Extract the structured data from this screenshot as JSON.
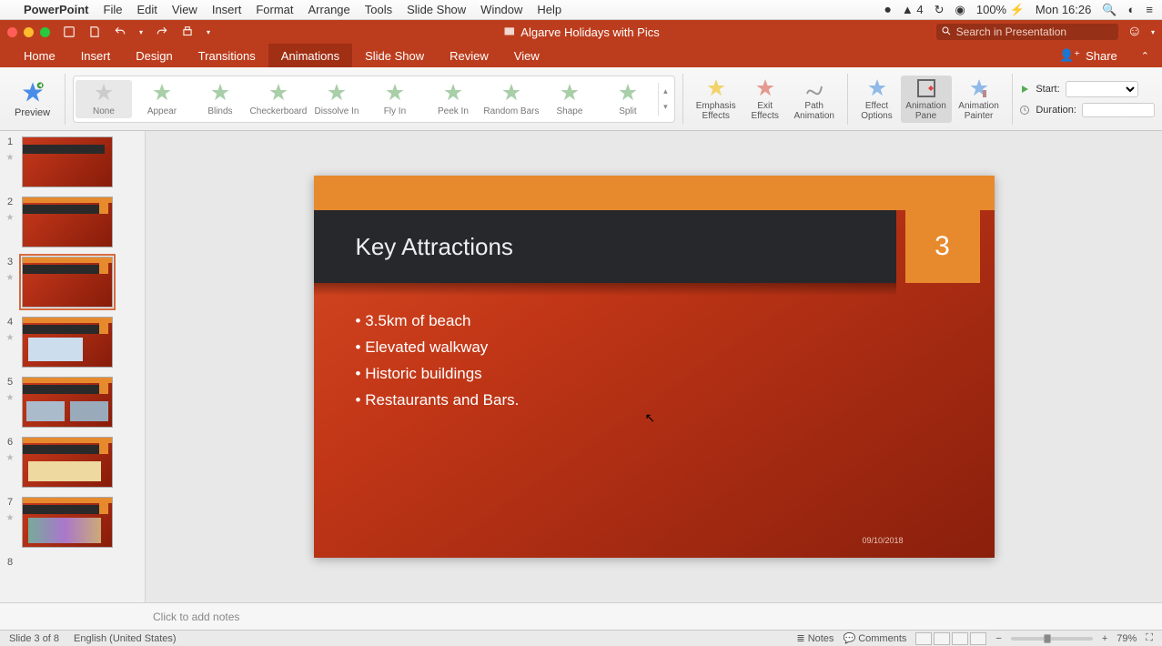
{
  "mac_menu": {
    "app": "PowerPoint",
    "items": [
      "File",
      "Edit",
      "View",
      "Insert",
      "Format",
      "Arrange",
      "Tools",
      "Slide Show",
      "Window",
      "Help"
    ],
    "adobe": "4",
    "battery": "100%",
    "clock": "Mon 16:26"
  },
  "titlebar": {
    "doc_title": "Algarve Holidays with Pics",
    "search_placeholder": "Search in Presentation"
  },
  "tabs": {
    "items": [
      "Home",
      "Insert",
      "Design",
      "Transitions",
      "Animations",
      "Slide Show",
      "Review",
      "View"
    ],
    "active": "Animations",
    "share": "Share"
  },
  "ribbon": {
    "preview": "Preview",
    "gallery": [
      "None",
      "Appear",
      "Blinds",
      "Checkerboard",
      "Dissolve In",
      "Fly In",
      "Peek In",
      "Random Bars",
      "Shape",
      "Split"
    ],
    "tools": {
      "emphasis": "Emphasis Effects",
      "exit": "Exit Effects",
      "path": "Path Animation",
      "options": "Effect Options",
      "pane": "Animation Pane",
      "painter": "Animation Painter"
    },
    "timing": {
      "start_label": "Start:",
      "start_value": "",
      "duration_label": "Duration:",
      "duration_value": ""
    }
  },
  "thumbs": {
    "count": 8,
    "selected": 3
  },
  "slide": {
    "title": "Key Attractions",
    "page": "3",
    "bullets": [
      "3.5km of beach",
      "Elevated walkway",
      "Historic buildings",
      "Restaurants and Bars."
    ],
    "date": "09/10/2018"
  },
  "notes": {
    "placeholder": "Click to add notes"
  },
  "status": {
    "slide_of": "Slide 3 of 8",
    "lang": "English (United States)",
    "notes": "Notes",
    "comments": "Comments",
    "zoom": "79%"
  }
}
